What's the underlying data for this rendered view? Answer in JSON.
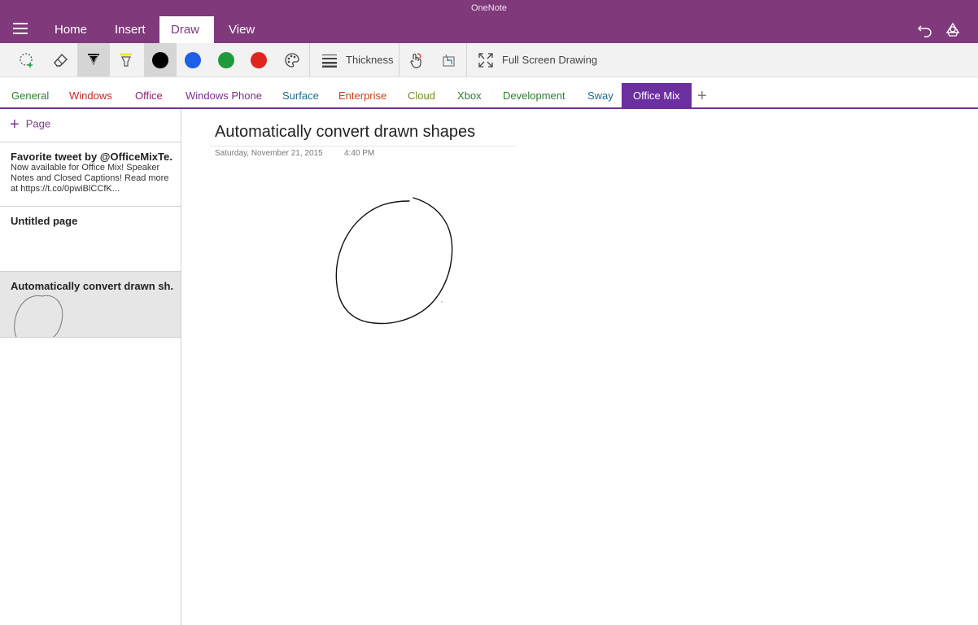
{
  "app": {
    "title": "OneNote"
  },
  "ribbon": {
    "tabs": [
      {
        "label": "Home"
      },
      {
        "label": "Insert"
      },
      {
        "label": "Draw",
        "active": true
      },
      {
        "label": "View"
      }
    ]
  },
  "toolbar": {
    "thickness_label": "Thickness",
    "fullscreen_label": "Full Screen Drawing",
    "colors": {
      "black": "#000000",
      "blue": "#1e5fe8",
      "green": "#1f9a3a",
      "red": "#e0251f",
      "highlighter": "#f5e71c"
    }
  },
  "sections": [
    {
      "label": "General",
      "color": "#2e7d32"
    },
    {
      "label": "Windows",
      "color": "#c62828"
    },
    {
      "label": "Office",
      "color": "#8e1f6b"
    },
    {
      "label": "Windows Phone",
      "color": "#7b2d8e"
    },
    {
      "label": "Surface",
      "color": "#1a6e8a"
    },
    {
      "label": "Enterprise",
      "color": "#c9421b"
    },
    {
      "label": "Cloud",
      "color": "#6a8e23"
    },
    {
      "label": "Xbox",
      "color": "#2e7d32"
    },
    {
      "label": "Development",
      "color": "#2e7d32"
    },
    {
      "label": "Sway",
      "color": "#1a6e8a"
    },
    {
      "label": "Office Mix",
      "color": "#ffffff",
      "active": true
    }
  ],
  "pagelist": {
    "add_label": "Page",
    "pages": [
      {
        "title": "Favorite tweet by @OfficeMixTe...",
        "preview": "Now available for Office Mix! Speaker Notes and Closed Captions! Read more at https://t.co/0pwiBlCCfK..."
      },
      {
        "title": "Untitled page",
        "preview": ""
      },
      {
        "title": "Automatically convert drawn sh...",
        "preview": "",
        "selected": true
      }
    ]
  },
  "page": {
    "title": "Automatically convert drawn shapes",
    "date": "Saturday, November 21, 2015",
    "time": "4:40 PM"
  }
}
